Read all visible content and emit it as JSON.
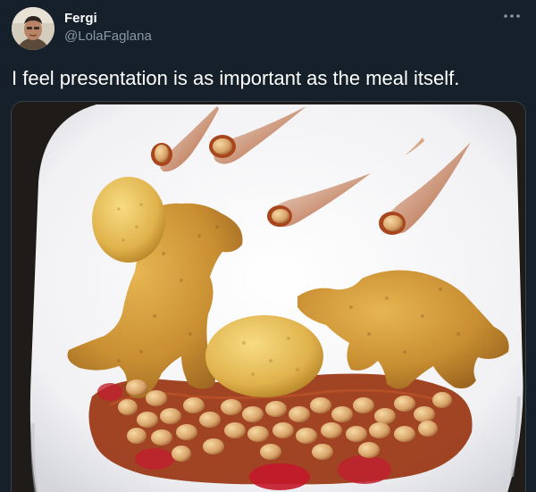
{
  "tweet": {
    "author_name": "Fergi",
    "author_handle": "@LolaFaglana",
    "more_icon": "more-horizontal-icon",
    "text": "I feel presentation is as important as the meal itself."
  },
  "colors": {
    "background": "#15202b",
    "primary_text": "#ffffff",
    "secondary_text": "#8899a6",
    "border": "#38444d"
  }
}
